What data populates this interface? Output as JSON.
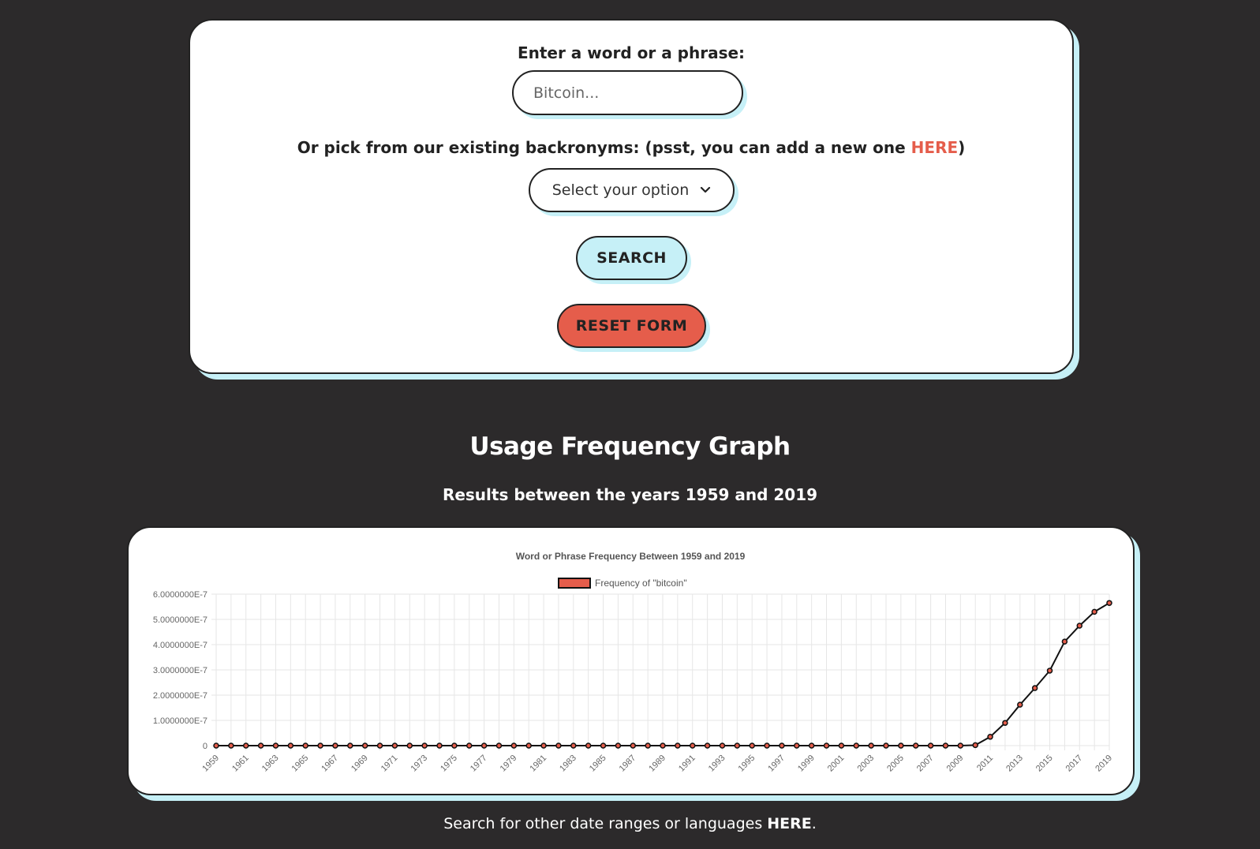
{
  "form": {
    "word_label": "Enter a word or a phrase:",
    "input_placeholder": "Bitcoin...",
    "pick_label_prefix": "Or pick from our existing backronyms: (psst, you can add a new one ",
    "pick_link": "HERE",
    "pick_label_suffix": ")",
    "select_value": "Select your option",
    "search_label": "SEARCH",
    "reset_label": "RESET FORM"
  },
  "graph_section": {
    "title": "Usage Frequency Graph",
    "subtitle": "Results between the years 1959 and 2019"
  },
  "footer": {
    "prefix": "Search for other date ranges or languages ",
    "link": "HERE",
    "suffix": "."
  },
  "colors": {
    "accent_red": "#e55d4b",
    "accent_cyan": "#c6f0f7",
    "background": "#2c2a2b"
  },
  "chart_data": {
    "type": "line",
    "title": "Word or Phrase Frequency Between 1959 and 2019",
    "legend": "Frequency of \"bitcoin\"",
    "legend_position": "top",
    "grid": true,
    "ylim": [
      0,
      6e-07
    ],
    "y_ticks": [
      "0",
      "1.0000000E-7",
      "2.0000000E-7",
      "3.0000000E-7",
      "4.0000000E-7",
      "5.0000000E-7",
      "6.0000000E-7"
    ],
    "x_tick_labels": [
      "1959",
      "1961",
      "1963",
      "1965",
      "1967",
      "1969",
      "1971",
      "1973",
      "1975",
      "1977",
      "1979",
      "1981",
      "1983",
      "1985",
      "1987",
      "1989",
      "1991",
      "1993",
      "1995",
      "1997",
      "1999",
      "2001",
      "2003",
      "2005",
      "2007",
      "2009",
      "2011",
      "2013",
      "2015",
      "2017",
      "2019"
    ],
    "x": [
      1959,
      1960,
      1961,
      1962,
      1963,
      1964,
      1965,
      1966,
      1967,
      1968,
      1969,
      1970,
      1971,
      1972,
      1973,
      1974,
      1975,
      1976,
      1977,
      1978,
      1979,
      1980,
      1981,
      1982,
      1983,
      1984,
      1985,
      1986,
      1987,
      1988,
      1989,
      1990,
      1991,
      1992,
      1993,
      1994,
      1995,
      1996,
      1997,
      1998,
      1999,
      2000,
      2001,
      2002,
      2003,
      2004,
      2005,
      2006,
      2007,
      2008,
      2009,
      2010,
      2011,
      2012,
      2013,
      2014,
      2015,
      2016,
      2017,
      2018,
      2019
    ],
    "values": [
      0,
      0,
      0,
      0,
      0,
      0,
      0,
      0,
      0,
      0,
      0,
      0,
      0,
      0,
      0,
      0,
      0,
      0,
      0,
      0,
      0,
      0,
      0,
      0,
      0,
      0,
      0,
      0,
      0,
      0,
      0,
      0,
      0,
      0,
      0,
      0,
      0,
      0,
      0,
      0,
      0,
      0,
      0,
      0,
      0,
      0,
      0,
      0,
      0,
      0,
      0,
      2e-09,
      3.5e-08,
      9e-08,
      1.62e-07,
      2.28e-07,
      2.97e-07,
      4.12e-07,
      4.75e-07,
      5.3e-07,
      5.65e-07
    ],
    "series_color": "#e55d4b",
    "line_color": "#111111"
  }
}
